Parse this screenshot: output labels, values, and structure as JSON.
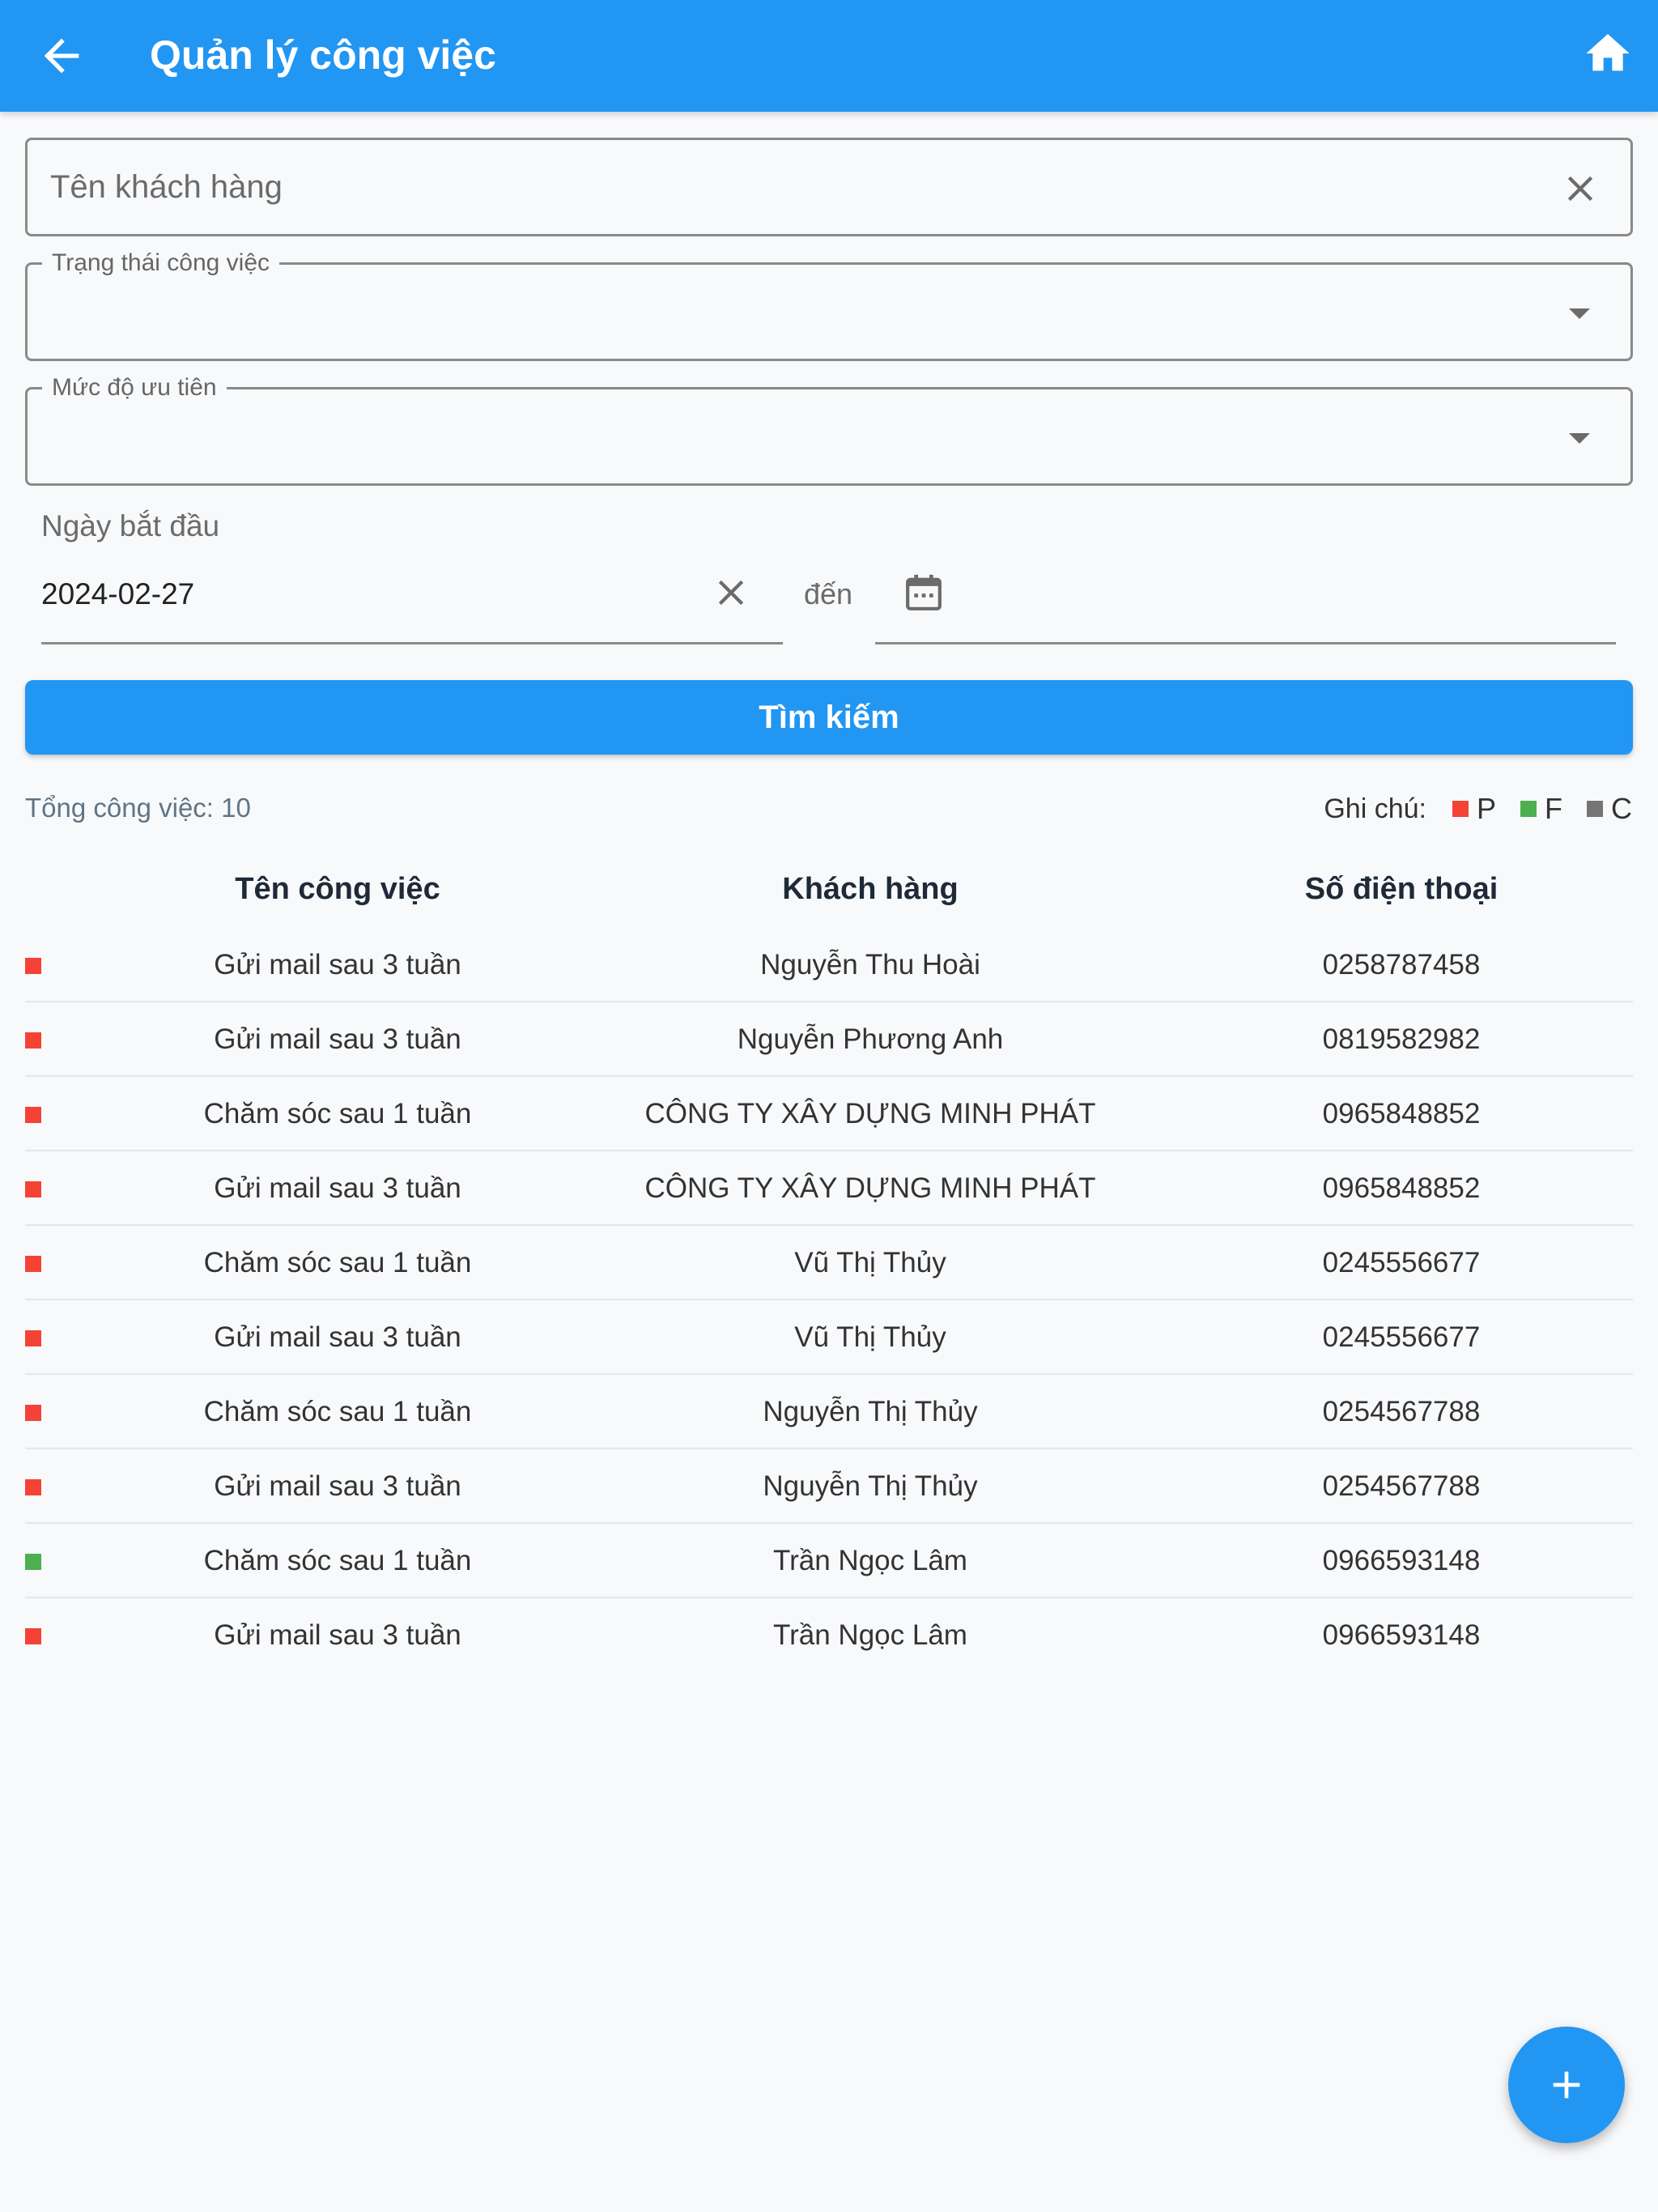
{
  "appbar": {
    "title": "Quản lý công việc"
  },
  "filters": {
    "customer_placeholder": "Tên khách hàng",
    "status_label": "Trạng thái công việc",
    "priority_label": "Mức độ ưu tiên",
    "start_date_label": "Ngày bắt đầu",
    "start_date_value": "2024-02-27",
    "to_label": "đến",
    "search_label": "Tìm kiếm"
  },
  "summary": {
    "total": "Tổng công việc: 10",
    "legend_label": "Ghi chú:",
    "legend": [
      {
        "letter": "P",
        "color": "#f44336"
      },
      {
        "letter": "F",
        "color": "#4caf50"
      },
      {
        "letter": "C",
        "color": "#757575"
      }
    ]
  },
  "table": {
    "headers": [
      "Tên công việc",
      "Khách hàng",
      "Số điện thoại"
    ],
    "rows": [
      {
        "status": "P",
        "color": "#f44336",
        "task": "Gửi mail sau 3 tuần",
        "customer": "Nguyễn Thu Hoài",
        "phone": "0258787458"
      },
      {
        "status": "P",
        "color": "#f44336",
        "task": "Gửi mail sau 3 tuần",
        "customer": "Nguyễn Phương Anh",
        "phone": "0819582982"
      },
      {
        "status": "P",
        "color": "#f44336",
        "task": "Chăm sóc sau 1 tuần",
        "customer": "CÔNG TY XÂY DỰNG MINH PHÁT",
        "phone": "0965848852"
      },
      {
        "status": "P",
        "color": "#f44336",
        "task": "Gửi mail sau 3 tuần",
        "customer": "CÔNG TY XÂY DỰNG MINH PHÁT",
        "phone": "0965848852"
      },
      {
        "status": "P",
        "color": "#f44336",
        "task": "Chăm sóc sau 1 tuần",
        "customer": "Vũ Thị Thủy",
        "phone": "0245556677"
      },
      {
        "status": "P",
        "color": "#f44336",
        "task": "Gửi mail sau 3 tuần",
        "customer": "Vũ Thị Thủy",
        "phone": "0245556677"
      },
      {
        "status": "P",
        "color": "#f44336",
        "task": "Chăm sóc sau 1 tuần",
        "customer": "Nguyễn Thị Thủy",
        "phone": "0254567788"
      },
      {
        "status": "P",
        "color": "#f44336",
        "task": "Gửi mail sau 3 tuần",
        "customer": "Nguyễn Thị Thủy",
        "phone": "0254567788"
      },
      {
        "status": "F",
        "color": "#4caf50",
        "task": "Chăm sóc sau 1 tuần",
        "customer": "Trần Ngọc Lâm",
        "phone": "0966593148"
      },
      {
        "status": "P",
        "color": "#f44336",
        "task": "Gửi mail sau 3 tuần",
        "customer": "Trần Ngọc Lâm",
        "phone": "0966593148"
      }
    ]
  },
  "icons": {
    "back": "arrow-back-icon",
    "home": "home-icon",
    "clear": "close-icon",
    "dropdown": "dropdown-arrow-icon",
    "calendar": "calendar-icon",
    "add": "add-icon"
  }
}
